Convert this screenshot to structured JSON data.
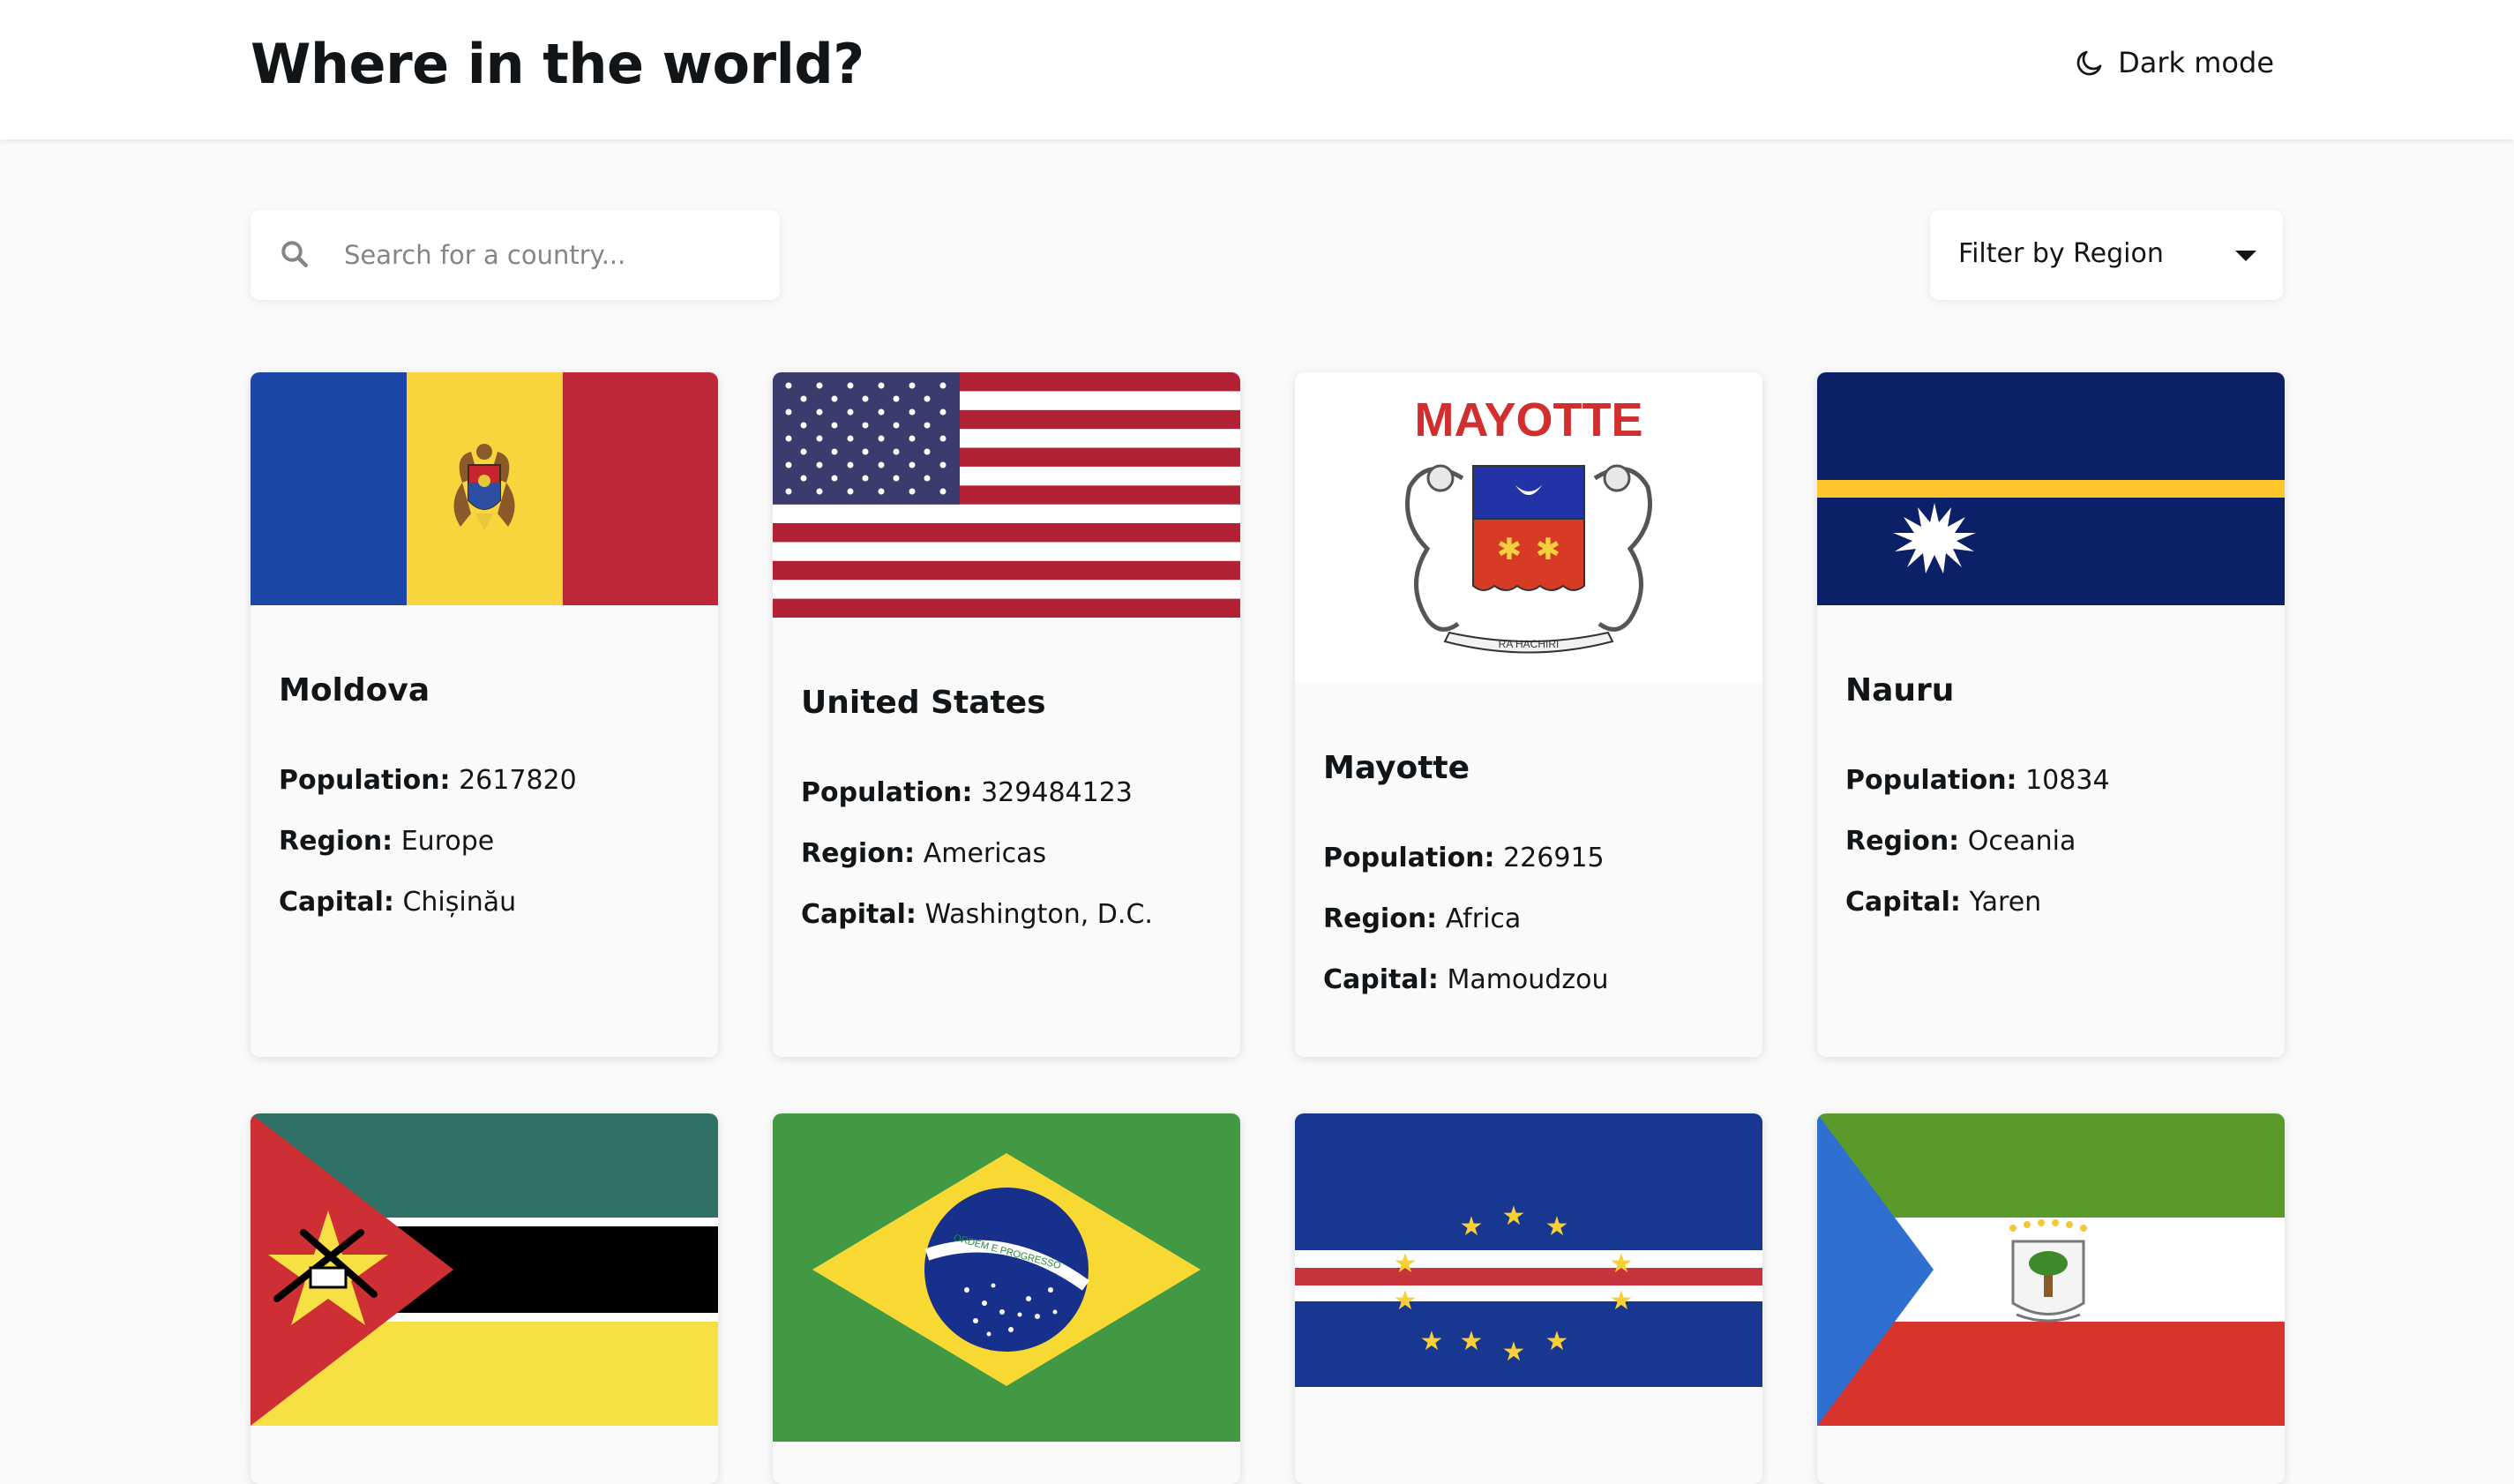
{
  "header": {
    "title": "Where in the world?",
    "theme_toggle_label": "Dark mode",
    "theme_toggle_icon": "moon-icon"
  },
  "controls": {
    "search_placeholder": "Search for a country...",
    "search_value": "",
    "search_icon": "search-icon",
    "filter_label": "Filter by Region",
    "filter_icon": "caret-down-icon"
  },
  "labels": {
    "population": "Population:",
    "region": "Region:",
    "capital": "Capital:"
  },
  "countries": [
    {
      "name": "Moldova",
      "population": "2617820",
      "region": "Europe",
      "capital": "Chișinău",
      "flag_image": "moldova-flag"
    },
    {
      "name": "United States",
      "population": "329484123",
      "region": "Americas",
      "capital": "Washington, D.C.",
      "flag_image": "united-states-flag"
    },
    {
      "name": "Mayotte",
      "population": "226915",
      "region": "Africa",
      "capital": "Mamoudzou",
      "flag_image": "mayotte-flag",
      "flag_text": "MAYOTTE",
      "flag_motto": "RA HACHIRI"
    },
    {
      "name": "Nauru",
      "population": "10834",
      "region": "Oceania",
      "capital": "Yaren",
      "flag_image": "nauru-flag"
    },
    {
      "name": "",
      "flag_image": "mozambique-flag"
    },
    {
      "name": "",
      "flag_image": "brazil-flag",
      "flag_motto": "ORDEM E PROGRESSO"
    },
    {
      "name": "",
      "flag_image": "cape-verde-flag"
    },
    {
      "name": "",
      "flag_image": "equatorial-guinea-flag"
    }
  ],
  "colors": {
    "background": "#fafafa",
    "surface": "#ffffff",
    "text": "#111517",
    "placeholder": "#858585"
  }
}
